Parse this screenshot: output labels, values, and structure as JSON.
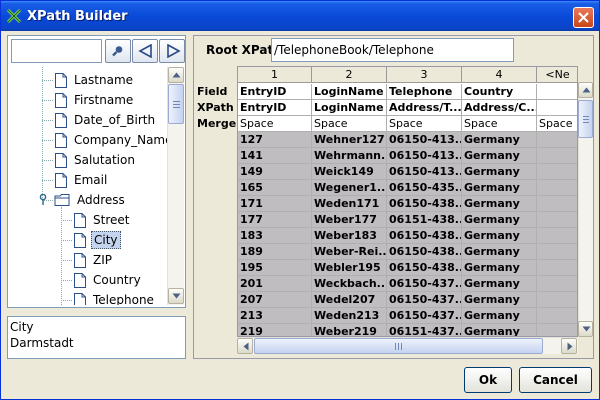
{
  "window": {
    "title": "XPath Builder"
  },
  "left": {
    "search": {
      "value": "",
      "placeholder": ""
    },
    "buttons": {
      "search_icon": "magnifier-icon",
      "prev_icon": "triangle-left-icon",
      "next_icon": "triangle-right-icon"
    },
    "tree": [
      {
        "label": "Lastname",
        "type": "file",
        "level": 1
      },
      {
        "label": "Firstname",
        "type": "file",
        "level": 1
      },
      {
        "label": "Date_of_Birth",
        "type": "file",
        "level": 1
      },
      {
        "label": "Company_Name",
        "type": "file",
        "level": 1
      },
      {
        "label": "Salutation",
        "type": "file",
        "level": 1
      },
      {
        "label": "Email",
        "type": "file",
        "level": 1
      },
      {
        "label": "Address",
        "type": "folder",
        "level": 1,
        "expanded": true
      },
      {
        "label": "Street",
        "type": "file",
        "level": 2
      },
      {
        "label": "City",
        "type": "file",
        "level": 2,
        "selected": true
      },
      {
        "label": "ZIP",
        "type": "file",
        "level": 2
      },
      {
        "label": "Country",
        "type": "file",
        "level": 2
      },
      {
        "label": "Telephone",
        "type": "file",
        "level": 2
      }
    ],
    "detail": {
      "line1": "City",
      "line2": "Darmstadt"
    }
  },
  "right": {
    "root_xpath_label": "Root XPath:",
    "root_xpath_value": "/TelephoneBook/Telephone",
    "row_labels": {
      "field": "Field",
      "xpath": "XPath",
      "merge": "Merge"
    },
    "columns": [
      {
        "header": "1",
        "field": "EntryID",
        "xpath": "EntryID",
        "merge": "Space"
      },
      {
        "header": "2",
        "field": "LoginName",
        "xpath": "LoginName",
        "merge": "Space"
      },
      {
        "header": "3",
        "field": "Telephone",
        "xpath": "Address/T...",
        "merge": "Space"
      },
      {
        "header": "4",
        "field": "Country",
        "xpath": "Address/C...",
        "merge": "Space"
      },
      {
        "header": "<Ne",
        "field": "",
        "xpath": "",
        "merge": "Space"
      }
    ],
    "rows": [
      [
        "127",
        "Wehner127",
        "06150-413...",
        "Germany",
        ""
      ],
      [
        "141",
        "Wehrmann...",
        "06150-413...",
        "Germany",
        ""
      ],
      [
        "149",
        "Weick149",
        "06150-413...",
        "Germany",
        ""
      ],
      [
        "165",
        "Wegener1...",
        "06150-435...",
        "Germany",
        ""
      ],
      [
        "171",
        "Weden171",
        "06150-438...",
        "Germany",
        ""
      ],
      [
        "177",
        "Weber177",
        "06151-438...",
        "Germany",
        ""
      ],
      [
        "183",
        "Weber183",
        "06150-438...",
        "Germany",
        ""
      ],
      [
        "189",
        "Weber-Rei...",
        "06150-438...",
        "Germany",
        ""
      ],
      [
        "195",
        "Webler195",
        "06150-438...",
        "Germany",
        ""
      ],
      [
        "201",
        "Weckbach...",
        "06150-437...",
        "Germany",
        ""
      ],
      [
        "207",
        "Wedel207",
        "06150-437...",
        "Germany",
        ""
      ],
      [
        "213",
        "Weden213",
        "06150-437...",
        "Germany",
        ""
      ],
      [
        "219",
        "Weber219",
        "06151-437...",
        "Germany",
        ""
      ]
    ]
  },
  "footer": {
    "ok_label": "Ok",
    "cancel_label": "Cancel"
  },
  "colors": {
    "title_bar": "#0a4ad8",
    "data_row_bg": "#c0bdc0",
    "selection": "#c4d4ee"
  }
}
